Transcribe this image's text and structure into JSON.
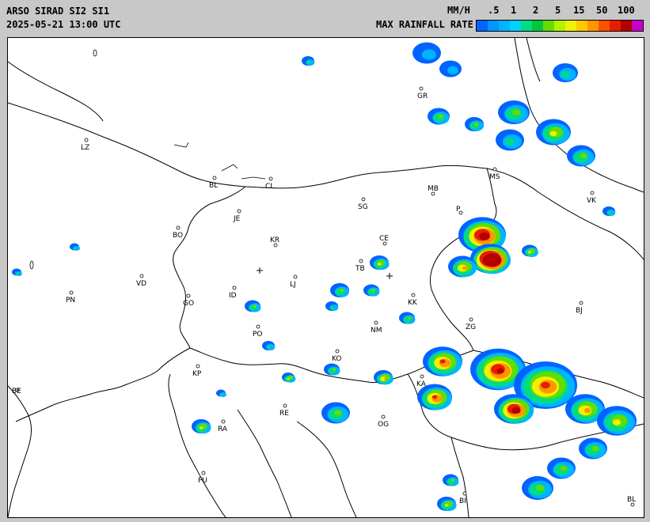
{
  "header": {
    "product": "ARSO SIRAD SI2 SI1",
    "timestamp": "2025-05-21 13:00 UTC",
    "units": "MM/H",
    "legend_title": "MAX RAINFALL RATE"
  },
  "legend": {
    "ticks": [
      ".5",
      "1",
      "2",
      "5",
      "15",
      "50",
      "100"
    ],
    "colors": [
      "#0064ff",
      "#0096ff",
      "#00b4ff",
      "#00d2ff",
      "#00dc82",
      "#00c83c",
      "#64dc00",
      "#b4f000",
      "#f0f000",
      "#ffc800",
      "#ff9600",
      "#ff5000",
      "#e61e00",
      "#b40000",
      "#c800c8"
    ]
  },
  "cities": [
    {
      "code": "GR"
    },
    {
      "code": "LZ"
    },
    {
      "code": "BL"
    },
    {
      "code": "CL"
    },
    {
      "code": "MB"
    },
    {
      "code": "MS"
    },
    {
      "code": "SG"
    },
    {
      "code": "VK"
    },
    {
      "code": "JE"
    },
    {
      "code": "BO"
    },
    {
      "code": "KR"
    },
    {
      "code": "CE"
    },
    {
      "code": "VD"
    },
    {
      "code": "TB"
    },
    {
      "code": "LJ"
    },
    {
      "code": "PN"
    },
    {
      "code": "GO"
    },
    {
      "code": "ID"
    },
    {
      "code": "KK"
    },
    {
      "code": "BJ"
    },
    {
      "code": "PO"
    },
    {
      "code": "NM"
    },
    {
      "code": "ZG"
    },
    {
      "code": "KO"
    },
    {
      "code": "KP"
    },
    {
      "code": "KA"
    },
    {
      "code": "RE"
    },
    {
      "code": "OG"
    },
    {
      "code": "RA"
    },
    {
      "code": "PU"
    },
    {
      "code": "BI"
    },
    {
      "code": "BL"
    },
    {
      "code": "BE"
    },
    {
      "code": "P"
    }
  ]
}
